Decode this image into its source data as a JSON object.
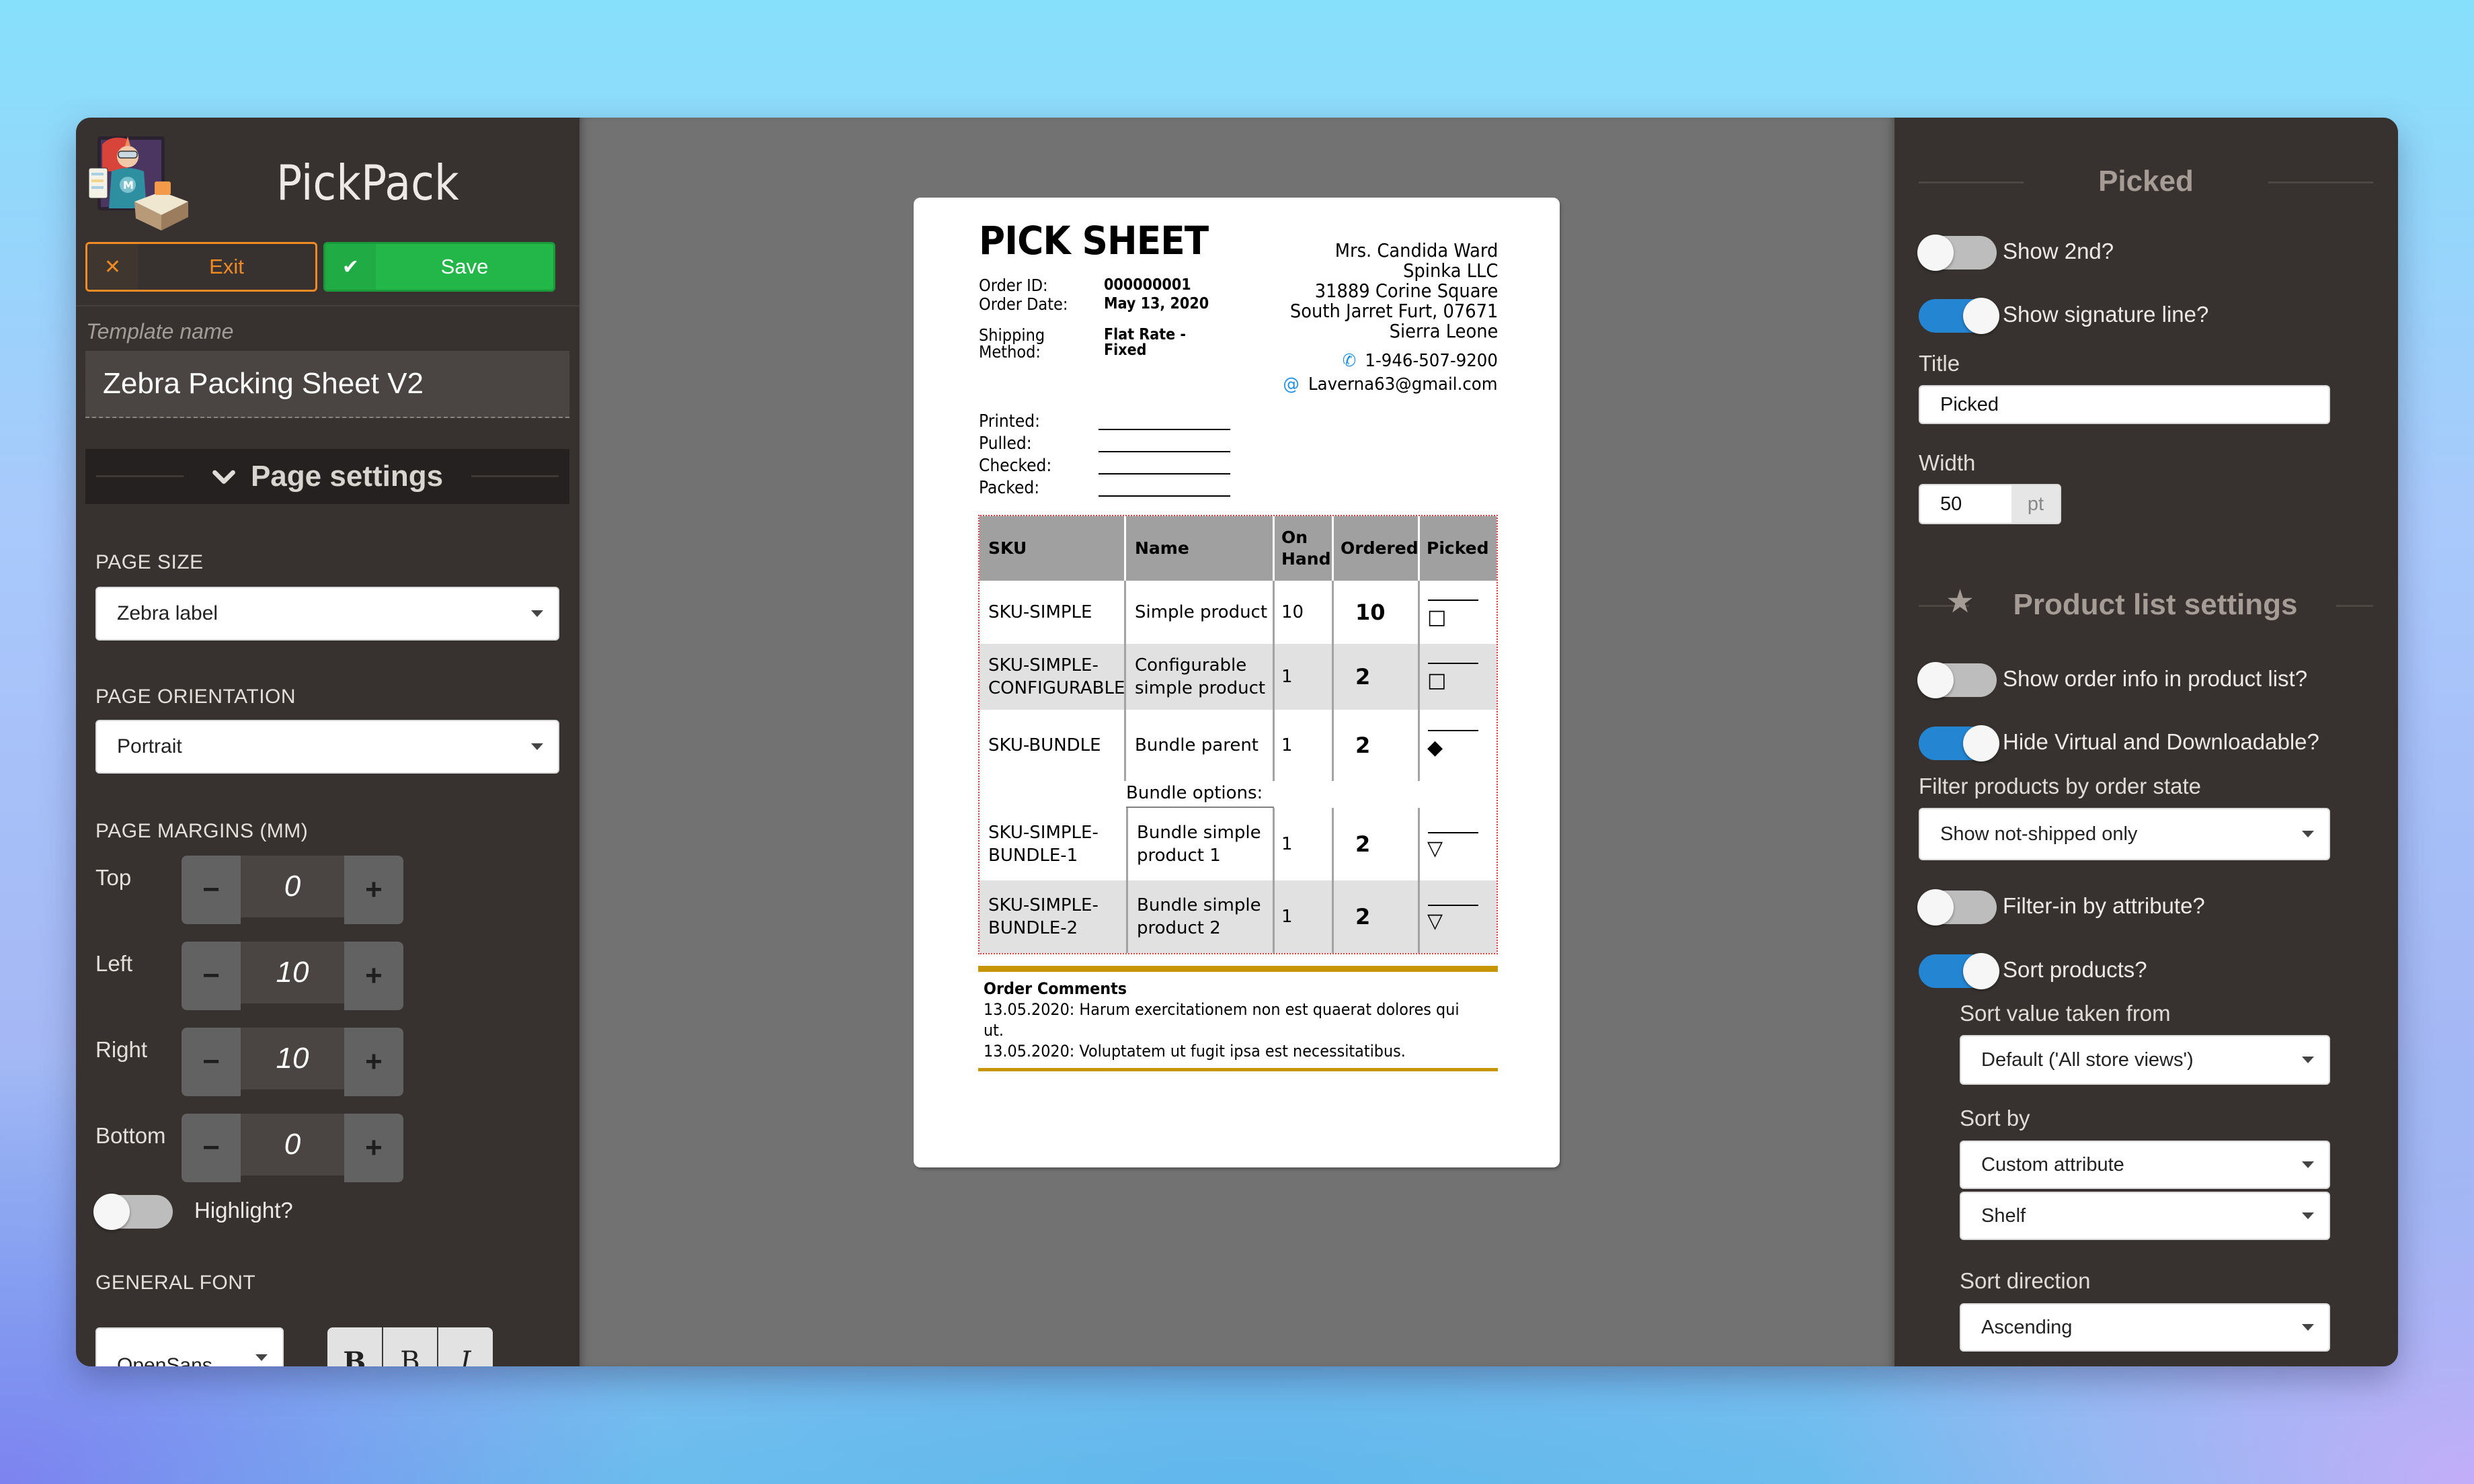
{
  "app": {
    "title": "PickPack"
  },
  "toolbar": {
    "exit_label": "Exit",
    "save_label": "Save"
  },
  "left": {
    "template_name_label": "Template name",
    "template_name_value": "Zebra Packing Sheet V2",
    "section_title": "Page settings",
    "page_size": {
      "label": "PAGE SIZE",
      "value": "Zebra label"
    },
    "page_orientation": {
      "label": "PAGE ORIENTATION",
      "value": "Portrait"
    },
    "margins": {
      "label": "PAGE MARGINS (MM)",
      "items": [
        {
          "label": "Top",
          "value": "0"
        },
        {
          "label": "Left",
          "value": "10"
        },
        {
          "label": "Right",
          "value": "10"
        },
        {
          "label": "Bottom",
          "value": "0"
        }
      ],
      "minus": "−",
      "plus": "+"
    },
    "highlight": {
      "label": "Highlight?",
      "on": false
    },
    "general_font": {
      "label": "GENERAL FONT",
      "value": "OpenSans"
    },
    "font_styles": [
      "B",
      "B",
      "I"
    ]
  },
  "document": {
    "title": "PICK SHEET",
    "order_id_label": "Order ID:",
    "order_id": "000000001",
    "order_date_label": "Order Date:",
    "order_date": "May 13, 2020",
    "shipping_label_1": "Shipping",
    "shipping_label_2": "Method:",
    "shipping_value_1": "Flat Rate -",
    "shipping_value_2": "Fixed",
    "address": [
      "Mrs. Candida Ward",
      "Spinka LLC",
      "31889 Corine Square",
      "South Jarret Furt, 07671",
      "Sierra Leone"
    ],
    "phone": "1-946-507-9200",
    "email": "Laverna63@gmail.com",
    "signatures": [
      "Printed:",
      "Pulled:",
      "Checked:",
      "Packed:"
    ],
    "table": {
      "headers": [
        "SKU",
        "Name",
        "On Hand",
        "Ordered",
        "Picked"
      ],
      "rows": [
        {
          "sku": "SKU-SIMPLE",
          "name": "Simple product",
          "on_hand": "10",
          "ordered": "10",
          "picked_glyph": "□"
        },
        {
          "sku": "SKU-SIMPLE-CONFIGURABLE",
          "name": "Configurable simple product",
          "on_hand": "1",
          "ordered": "2",
          "picked_glyph": "□"
        },
        {
          "sku": "SKU-BUNDLE",
          "name": "Bundle parent",
          "on_hand": "1",
          "ordered": "2",
          "picked_glyph": "◆"
        }
      ],
      "bundle_label": "Bundle options:",
      "bundle_rows": [
        {
          "sku": "SKU-SIMPLE-BUNDLE-1",
          "name": "Bundle simple product 1",
          "on_hand": "1",
          "ordered": "2",
          "picked_glyph": "▽"
        },
        {
          "sku": "SKU-SIMPLE-BUNDLE-2",
          "name": "Bundle simple product 2",
          "on_hand": "1",
          "ordered": "2",
          "picked_glyph": "▽"
        }
      ]
    },
    "comments": {
      "title": "Order Comments",
      "lines": [
        "13.05.2020: Harum exercitationem non est quaerat dolores qui",
        "ut.",
        "13.05.2020: Voluptatem ut fugit ipsa est necessitatibus."
      ]
    }
  },
  "right": {
    "picked_section": {
      "title": "Picked",
      "show_2nd": {
        "label": "Show 2nd?",
        "on": false
      },
      "show_signature": {
        "label": "Show signature line?",
        "on": true
      },
      "title_label": "Title",
      "title_value": "Picked",
      "width_label": "Width",
      "width_value": "50",
      "width_unit": "pt"
    },
    "product_list": {
      "title": "Product list settings",
      "show_order_info": {
        "label": "Show order info in product list?",
        "on": false
      },
      "hide_virtual": {
        "label": "Hide Virtual and Downloadable?",
        "on": true
      },
      "filter_state_label": "Filter products by order state",
      "filter_state_value": "Show not-shipped only",
      "filter_attr": {
        "label": "Filter-in by attribute?",
        "on": false
      },
      "sort_products": {
        "label": "Sort products?",
        "on": true
      },
      "sort_value_label": "Sort value taken from",
      "sort_value_value": "Default ('All store views')",
      "sort_by_label": "Sort by",
      "sort_by_value": "Custom attribute",
      "sort_attr_value": "Shelf",
      "sort_direction_label": "Sort direction",
      "sort_direction_value": "Ascending"
    }
  },
  "colors": {
    "panel_bg": "#373230",
    "canvas_bg": "#727272",
    "exit_orange": "#f08a24",
    "save_green": "#23b74a",
    "toggle_on": "#2485d2",
    "comments_rule": "#c69607",
    "table_border_highlight": "#e23b3b"
  }
}
